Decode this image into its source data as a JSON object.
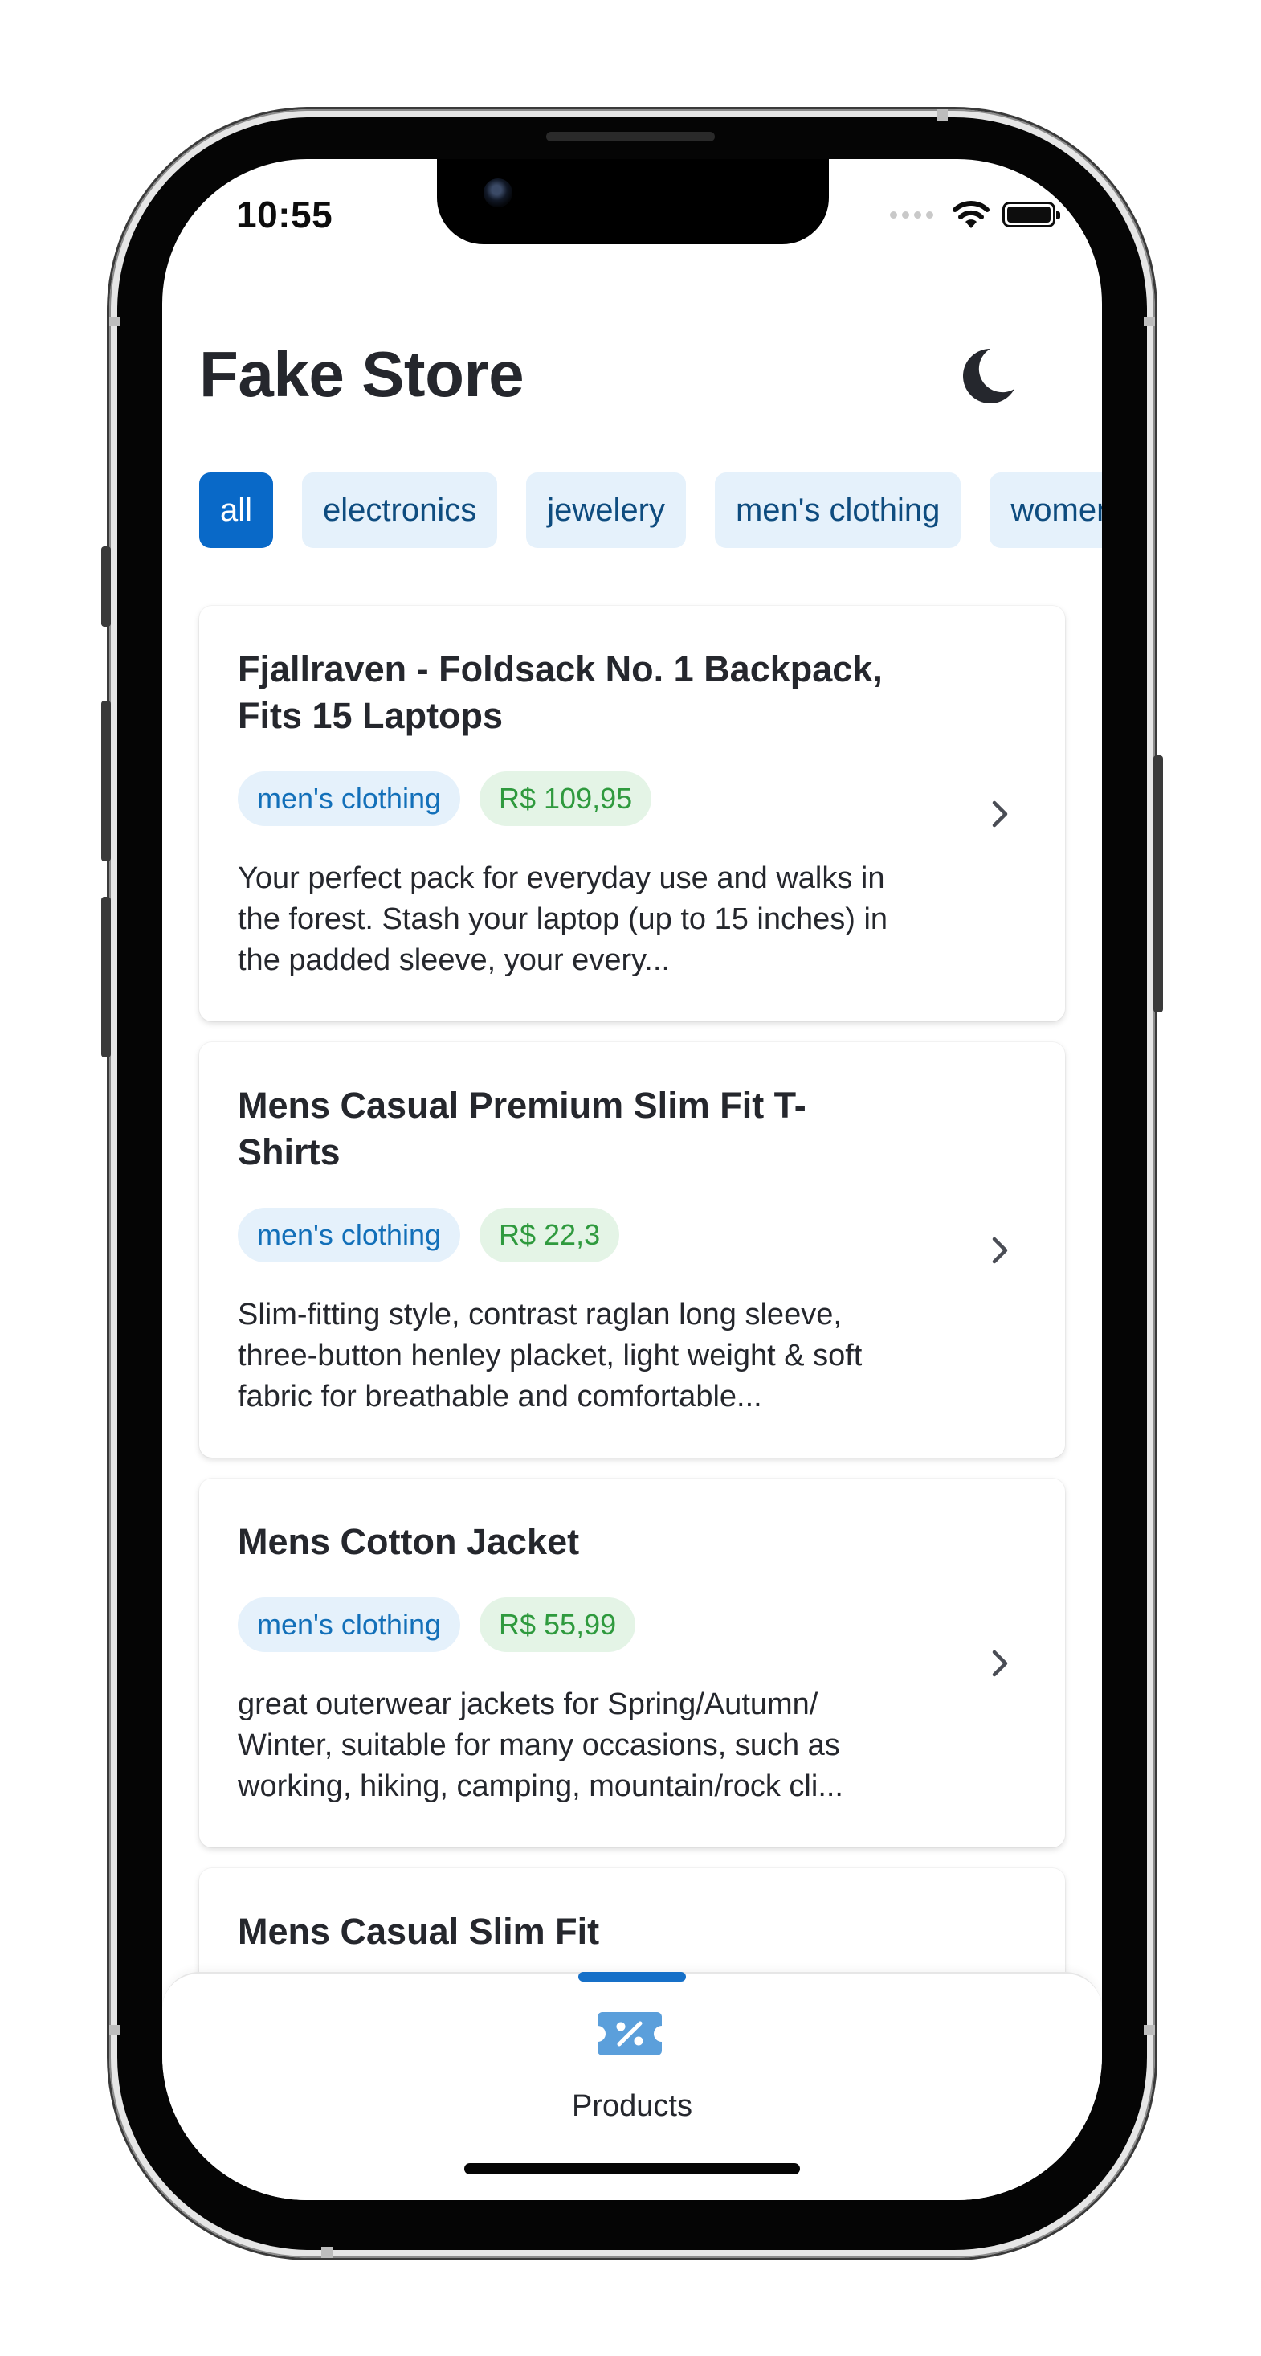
{
  "status_bar": {
    "time": "10:55"
  },
  "header": {
    "title": "Fake Store",
    "theme_toggle_icon": "moon-icon"
  },
  "categories": [
    {
      "label": "all",
      "active": true
    },
    {
      "label": "electronics",
      "active": false
    },
    {
      "label": "jewelery",
      "active": false
    },
    {
      "label": "men's clothing",
      "active": false
    },
    {
      "label": "women's clothing",
      "active": false
    }
  ],
  "products": [
    {
      "title": "Fjallraven - Foldsack No. 1 Backpack, Fits 15 Laptops",
      "category": "men's clothing",
      "price": "R$ 109,95",
      "description": "Your perfect pack for everyday use and walks in the forest. Stash your laptop (up to 15 inches) in the padded sleeve, your every..."
    },
    {
      "title": "Mens Casual Premium Slim Fit T-Shirts",
      "category": "men's clothing",
      "price": "R$ 22,3",
      "description": "Slim-fitting style, contrast raglan long sleeve, three-button henley placket, light weight & soft fabric for breathable and comfortable..."
    },
    {
      "title": "Mens Cotton Jacket",
      "category": "men's clothing",
      "price": "R$ 55,99",
      "description": "great outerwear jackets for Spring/Autumn/ Winter, suitable for many occasions, such as working, hiking, camping, mountain/rock cli..."
    },
    {
      "title": "Mens Casual Slim Fit",
      "category": "",
      "price": "",
      "description": ""
    }
  ],
  "tabbar": {
    "label": "Products",
    "icon": "discount-ticket-icon"
  },
  "colors": {
    "accent": "#0969c8",
    "chip_bg": "#e5f1fb",
    "chip_text": "#0e4c7f",
    "category_badge_text": "#1370b9",
    "price_badge_bg": "#e4f4e6",
    "price_badge_text": "#2f9a3e",
    "text": "#25272d"
  }
}
